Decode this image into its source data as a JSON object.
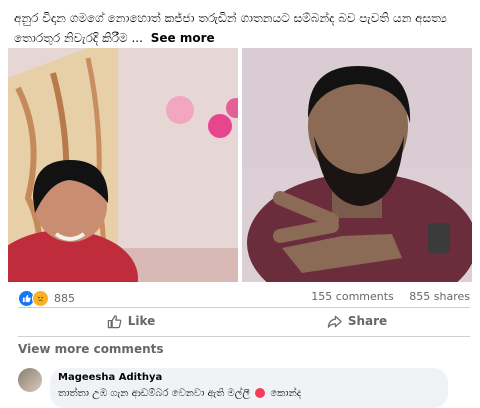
{
  "post": {
    "text": "අනුර විදාන ගමගේ නොහොත් කජ්ජා තරුඩින් ගාතනයට සම්බන්ද බව පැවති යන අසත්‍ය තොරතුර නිවැරදි කිරීම ...",
    "see_more": "See more"
  },
  "photos": {
    "left_alt": "Selfie of a woman in a pink room",
    "right_alt": "Bearded man making a peace sign"
  },
  "reactions": {
    "icons": [
      "like-icon",
      "sad-icon"
    ],
    "count": "885"
  },
  "stats": {
    "comments": "155 comments",
    "shares": "855 shares"
  },
  "actions": {
    "like_label": "Like",
    "share_label": "Share"
  },
  "comments": {
    "view_more": "View more comments",
    "items": [
      {
        "author": "Mageesha Adithya",
        "text": "තාත්තා උඹ ගැන ආඩම්බර වෙනවා ඇති මල්ලී",
        "text_suffix": "කොන්ද"
      }
    ]
  },
  "colors": {
    "accent": "#1877f2",
    "muted_text": "#65676b",
    "bubble": "#f0f2f5"
  }
}
